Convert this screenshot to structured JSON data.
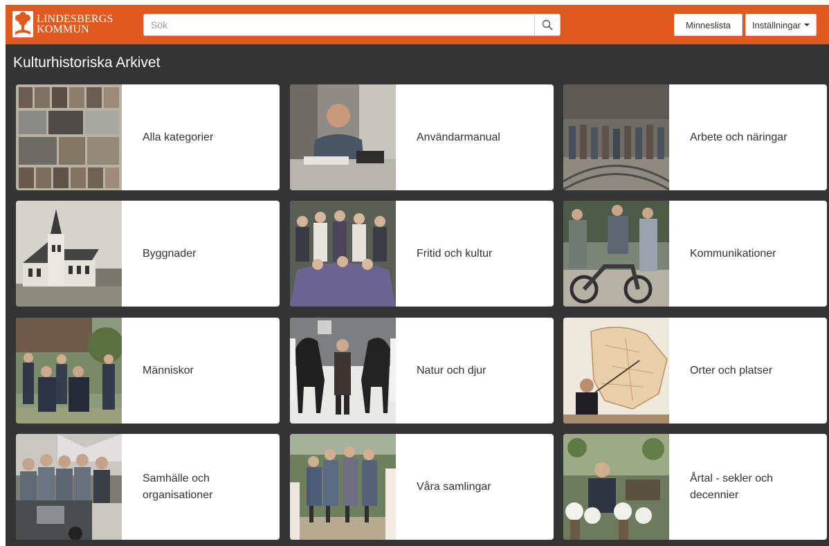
{
  "header": {
    "logo_line1": "LINDESBERGS",
    "logo_line2": "KOMMUN",
    "search_placeholder": "Sök",
    "memory_list": "Minneslista",
    "settings": "Inställningar"
  },
  "page_title": "Kulturhistoriska Arkivet",
  "categories": [
    {
      "label": "Alla kategorier",
      "image": "photo-collage"
    },
    {
      "label": "Användarmanual",
      "image": "man-at-desk-telephone"
    },
    {
      "label": "Arbete och näringar",
      "image": "workers-group-rail-tracks"
    },
    {
      "label": "Byggnader",
      "image": "villa-with-tower"
    },
    {
      "label": "Fritid och kultur",
      "image": "theater-group-costumes"
    },
    {
      "label": "Kommunikationer",
      "image": "motorcycle-people"
    },
    {
      "label": "Människor",
      "image": "family-outdoors"
    },
    {
      "label": "Natur och djur",
      "image": "man-with-horses-snow"
    },
    {
      "label": "Orter och platser",
      "image": "man-pointing-map"
    },
    {
      "label": "Samhälle och organisationer",
      "image": "truck-and-group"
    },
    {
      "label": "Våra samlingar",
      "image": "women-on-bridge"
    },
    {
      "label": "Årtal - sekler och decennier",
      "image": "man-seated-flowers"
    }
  ],
  "colors": {
    "header": "#e0591e",
    "background": "#343434",
    "card": "#ffffff",
    "text": "#333333"
  }
}
